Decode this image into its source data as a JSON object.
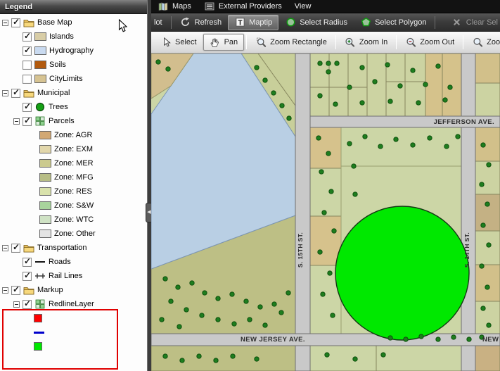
{
  "legend": {
    "title": "Legend",
    "items": [
      {
        "label": "Base Map",
        "checked": true
      },
      {
        "label": "Islands",
        "checked": true,
        "swatch": "#d8cda6"
      },
      {
        "label": "Hydrography",
        "checked": true,
        "swatch": "#c9daf0"
      },
      {
        "label": "Soils",
        "checked": false,
        "swatch": "#b25a0e"
      },
      {
        "label": "CityLimits",
        "checked": false,
        "swatch": "#d6c392"
      },
      {
        "label": "Municipal",
        "checked": true
      },
      {
        "label": "Trees",
        "checked": true
      },
      {
        "label": "Parcels",
        "checked": true
      },
      {
        "label": "Zone: AGR",
        "swatch": "#d2a873"
      },
      {
        "label": "Zone: EXM",
        "swatch": "#e2d7ab"
      },
      {
        "label": "Zone: MER",
        "swatch": "#cbca8e"
      },
      {
        "label": "Zone: MFG",
        "swatch": "#b7bd85"
      },
      {
        "label": "Zone: RES",
        "swatch": "#d9e2ab"
      },
      {
        "label": "Zone: S&W",
        "swatch": "#a8d49c"
      },
      {
        "label": "Zone: WTC",
        "swatch": "#cfe2c4"
      },
      {
        "label": "Zone: Other",
        "swatch": "#e4e4e4"
      },
      {
        "label": "Transportation",
        "checked": true
      },
      {
        "label": "Roads",
        "checked": true
      },
      {
        "label": "Rail Lines",
        "checked": true
      },
      {
        "label": "Markup",
        "checked": true
      },
      {
        "label": "RedlineLayer",
        "checked": true
      }
    ],
    "redline_swatches": {
      "point": "#ff0000",
      "line": "#0000cc",
      "polygon": "#00e800"
    }
  },
  "menubar": {
    "items": [
      {
        "label": "Maps"
      },
      {
        "label": "External Providers"
      },
      {
        "label": "View"
      }
    ]
  },
  "toolbar_top": {
    "buttons": [
      {
        "label": "lot"
      },
      {
        "label": "Refresh"
      },
      {
        "label": "Maptip",
        "active": true,
        "icon_letter": "T"
      },
      {
        "label": "Select Radius"
      },
      {
        "label": "Select Polygon"
      },
      {
        "label": "Clear Sel",
        "disabled": true
      }
    ]
  },
  "toolbar_map": {
    "buttons": [
      {
        "label": "Select"
      },
      {
        "label": "Pan",
        "active": true
      },
      {
        "label": "Zoom Rectangle"
      },
      {
        "label": "Zoom In"
      },
      {
        "label": "Zoom Out"
      },
      {
        "label": "Zoom Ex"
      }
    ]
  },
  "map": {
    "street_labels": {
      "jefferson": "JEFFERSON AVE.",
      "s15th": "S. 15TH ST.",
      "s14th": "S. 14TH ST.",
      "new_jersey": "NEW JERSEY AVE.",
      "new_partial": "NEW"
    },
    "markup_circle_color": "#00e800",
    "water_color": "#b9cfe4",
    "tree_color": "#1e7d1e"
  }
}
